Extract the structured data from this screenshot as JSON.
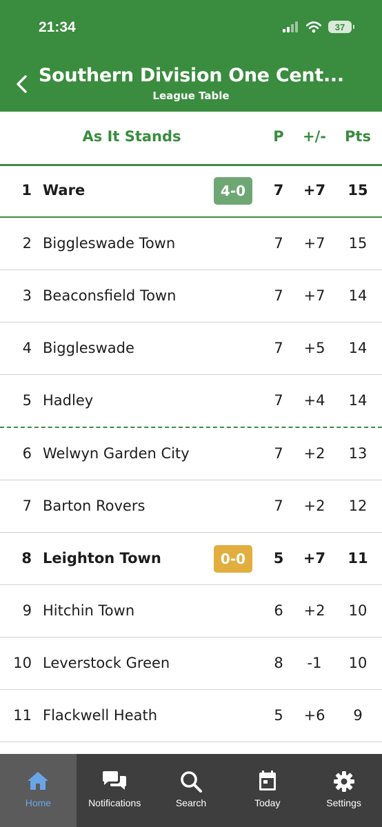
{
  "status_bar": {
    "time": "21:34",
    "battery": "37"
  },
  "header": {
    "title": "Southern Division One Cent...",
    "subtitle": "League Table"
  },
  "table": {
    "headers": {
      "team": "As It Stands",
      "p": "P",
      "gd": "+/-",
      "pts": "Pts"
    },
    "rows": [
      {
        "pos": "1",
        "team": "Ware",
        "p": "7",
        "gd": "+7",
        "pts": "15",
        "score": "4-0",
        "score_color": "#6fa774",
        "bold": true,
        "style": "hl"
      },
      {
        "pos": "2",
        "team": "Biggleswade Town",
        "p": "7",
        "gd": "+7",
        "pts": "15"
      },
      {
        "pos": "3",
        "team": "Beaconsfield Town",
        "p": "7",
        "gd": "+7",
        "pts": "14"
      },
      {
        "pos": "4",
        "team": "Biggleswade",
        "p": "7",
        "gd": "+5",
        "pts": "14"
      },
      {
        "pos": "5",
        "team": "Hadley",
        "p": "7",
        "gd": "+4",
        "pts": "14",
        "style": "cut"
      },
      {
        "pos": "6",
        "team": "Welwyn Garden City",
        "p": "7",
        "gd": "+2",
        "pts": "13"
      },
      {
        "pos": "7",
        "team": "Barton Rovers",
        "p": "7",
        "gd": "+2",
        "pts": "12"
      },
      {
        "pos": "8",
        "team": "Leighton Town",
        "p": "5",
        "gd": "+7",
        "pts": "11",
        "score": "0-0",
        "score_color": "#e2ae3f",
        "bold": true
      },
      {
        "pos": "9",
        "team": "Hitchin Town",
        "p": "6",
        "gd": "+2",
        "pts": "10"
      },
      {
        "pos": "10",
        "team": "Leverstock Green",
        "p": "8",
        "gd": "-1",
        "pts": "10"
      },
      {
        "pos": "11",
        "team": "Flackwell Heath",
        "p": "5",
        "gd": "+6",
        "pts": "9"
      }
    ]
  },
  "tabbar": [
    {
      "label": "Home",
      "icon": "home-icon",
      "active": true
    },
    {
      "label": "Notifications",
      "icon": "chat-bubbles-icon"
    },
    {
      "label": "Search",
      "icon": "search-icon"
    },
    {
      "label": "Today",
      "icon": "calendar-icon"
    },
    {
      "label": "Settings",
      "icon": "gear-icon"
    }
  ],
  "colors": {
    "brand_green": "#3a8c3f",
    "tab_bar": "#3e3e3e",
    "tab_active": "#5b5b5b",
    "tab_active_text": "#6aa5e8"
  }
}
